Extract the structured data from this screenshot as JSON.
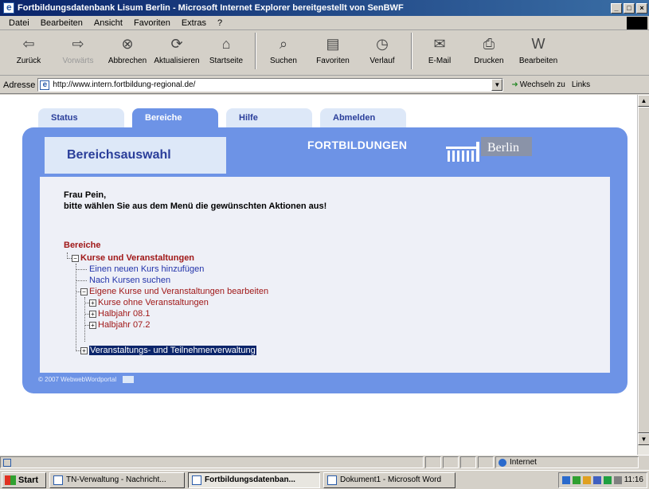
{
  "window": {
    "title": "Fortbildungsdatenbank Lisum Berlin - Microsoft Internet Explorer bereitgestellt von SenBWF",
    "controls": [
      "_",
      "□",
      "×"
    ]
  },
  "menu": [
    "Datei",
    "Bearbeiten",
    "Ansicht",
    "Favoriten",
    "Extras",
    "?"
  ],
  "toolbar": {
    "back": "Zurück",
    "forward": "Vorwärts",
    "stop": "Abbrechen",
    "refresh": "Aktualisieren",
    "home": "Startseite",
    "search": "Suchen",
    "favorites": "Favoriten",
    "history": "Verlauf",
    "mail": "E-Mail",
    "print": "Drucken",
    "edit": "Bearbeiten"
  },
  "address": {
    "label": "Adresse",
    "url": "http://www.intern.fortbildung-regional.de/",
    "go": "Wechseln zu",
    "links": "Links"
  },
  "page": {
    "tabs": [
      "Status",
      "Bereiche",
      "Hilfe",
      "Abmelden"
    ],
    "header_title": "Bereichsauswahl",
    "header_brand": "FORTBILDUNGEN",
    "logo_text": "Berlin",
    "greeting_line1": "Frau Pein,",
    "greeting_line2": "bitte wählen Sie aus dem Menü die gewünschten Aktionen aus!",
    "section": "Bereiche",
    "tree": {
      "root": "Kurse und Veranstaltungen",
      "add_course": "Einen neuen Kurs hinzufügen",
      "search_course": "Nach Kursen suchen",
      "own": "Eigene Kurse und Veranstaltungen bearbeiten",
      "no_events": "Kurse ohne Veranstaltungen",
      "h081": "Halbjahr 08.1",
      "h072": "Halbjahr 07.2",
      "admin": "Veranstaltungs- und Teilnehmerverwaltung"
    },
    "footer": "© 2007 WebwebWordportal"
  },
  "statusbar": {
    "zone": "Internet"
  },
  "taskbar": {
    "start": "Start",
    "tasks": [
      "TN-Verwaltung - Nachricht...",
      "Fortbildungsdatenban...",
      "Dokument1 - Microsoft Word"
    ],
    "clock": "11:16"
  },
  "colors": {
    "panel": "#6d93e6",
    "tab": "#dde8f8",
    "heading_red": "#a01818",
    "link_blue": "#2233aa",
    "selection": "#0a246a"
  }
}
